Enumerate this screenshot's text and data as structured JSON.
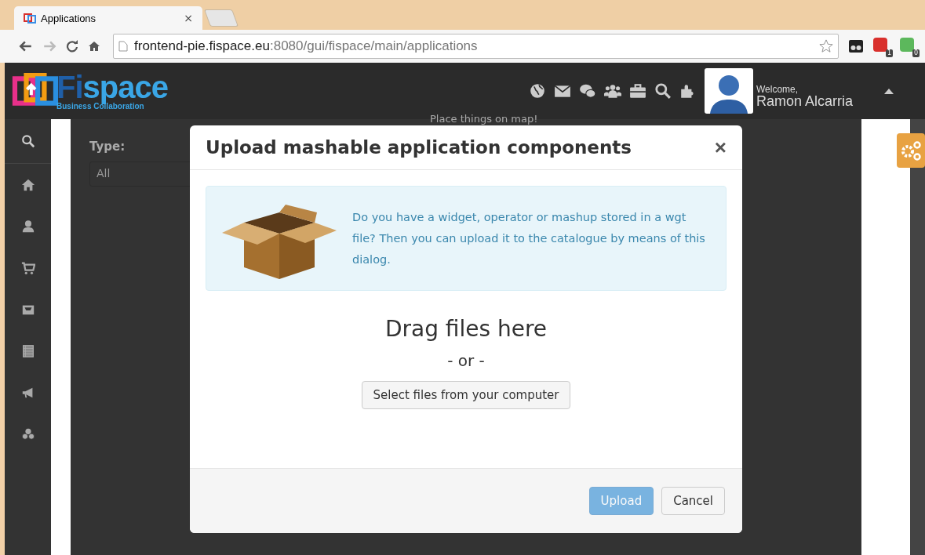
{
  "browser": {
    "tab": {
      "title": "Applications",
      "close": "×"
    },
    "address": {
      "host": "frontend-pie.fispace.eu",
      "path": ":8080/gui/fispace/main/applications"
    },
    "extensions": [
      {
        "badge": "1",
        "color": "#d9302c"
      },
      {
        "badge": "0",
        "color": "#5cb85c"
      }
    ]
  },
  "header": {
    "logo": {
      "prefix": "Fi",
      "name": "space",
      "tagline": "Business Collaboration"
    },
    "welcome": "Welcome,",
    "user": "Ramon Alcarria"
  },
  "background": {
    "type_label": "Type:",
    "type_value": "All",
    "map_text": "Place things on map!"
  },
  "dialog": {
    "title": "Upload mashable application components",
    "close": "×",
    "info": "Do you have a widget, operator or mashup stored in a wgt file? Then you can upload it to the catalogue by means of this dialog.",
    "drop_text": "Drag files here",
    "or_text": "- or -",
    "select_button": "Select files from your computer",
    "buttons": [
      {
        "label": "Upload",
        "kind": "primary",
        "disabled": true
      },
      {
        "label": "Cancel",
        "kind": "default",
        "disabled": false
      }
    ]
  }
}
